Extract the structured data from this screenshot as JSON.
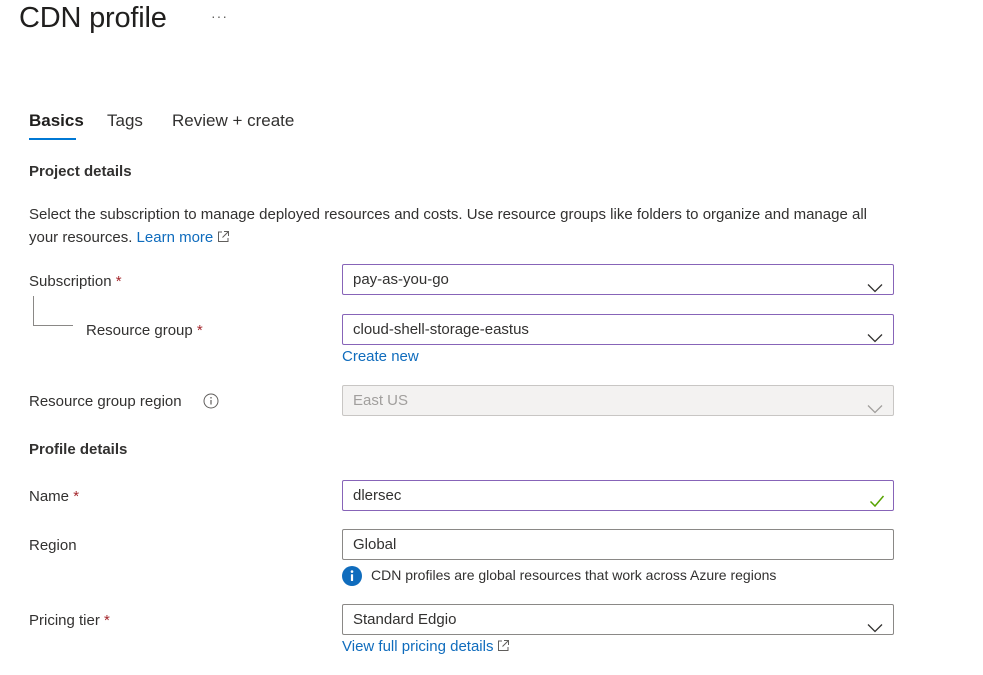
{
  "header": {
    "title": "CDN profile",
    "more_label": "···"
  },
  "tabs": [
    {
      "label": "Basics",
      "active": true
    },
    {
      "label": "Tags",
      "active": false
    },
    {
      "label": "Review + create",
      "active": false
    }
  ],
  "project_details": {
    "heading": "Project details",
    "description": "Select the subscription to manage deployed resources and costs. Use resource groups like folders to organize and manage all your resources.",
    "learn_more": "Learn more"
  },
  "subscription": {
    "label": "Subscription",
    "required_mark": "*",
    "value": "pay-as-you-go"
  },
  "resource_group": {
    "label": "Resource group",
    "required_mark": "*",
    "value": "cloud-shell-storage-eastus",
    "create_new": "Create new"
  },
  "resource_group_region": {
    "label": "Resource group region",
    "value": "East US",
    "info_icon": "info-icon"
  },
  "profile_details": {
    "heading": "Profile details"
  },
  "name": {
    "label": "Name",
    "required_mark": "*",
    "value": "dlersec",
    "valid_icon": "checkmark-icon"
  },
  "region": {
    "label": "Region",
    "value": "Global",
    "notice": "CDN profiles are global resources that work across Azure regions"
  },
  "pricing_tier": {
    "label": "Pricing tier",
    "required_mark": "*",
    "value": "Standard Edgio",
    "details_link": "View full pricing details"
  },
  "colors": {
    "link": "#0f6cbd",
    "accent": "#0078d4",
    "focus_border": "#8764b8",
    "required": "#a4262c",
    "valid": "#57a300"
  }
}
